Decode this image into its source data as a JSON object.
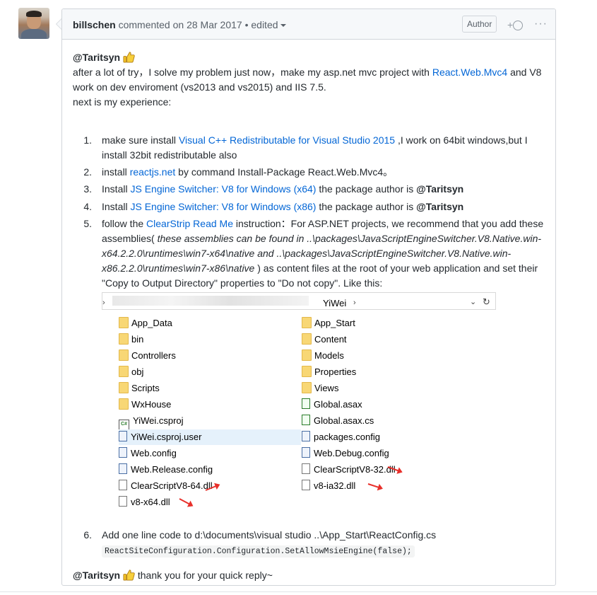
{
  "comment": {
    "author": "billschen",
    "action": "commented on",
    "date": "28 Mar 2017",
    "separator": "•",
    "edited": "edited",
    "author_badge": "Author",
    "reaction_plus": "+",
    "more_menu": "···"
  },
  "body": {
    "mention": "@Taritsyn",
    "intro_text_1": "after a lot of try，I solve my problem just now，make my asp.net mvc project with ",
    "intro_link": "React.Web.Mvc4",
    "intro_text_2": " and V8 work on dev enviroment (vs2013 and vs2015) and IIS 7.5.",
    "intro_text_3": "next is my experience:",
    "steps": [
      {
        "num": "1.",
        "pre": "make sure install ",
        "link": "Visual C++ Redistributable for Visual Studio 2015 ",
        "post": ",I work on 64bit windows,but I install 32bit redistributable also"
      },
      {
        "num": "2.",
        "pre": "install ",
        "link": "reactjs.net",
        "post": " by command Install-Package React.Web.Mvc4。"
      },
      {
        "num": "3.",
        "pre": "Install ",
        "link": "JS Engine Switcher: V8 for Windows (x64)",
        "post": " the package author is ",
        "mention": "@Taritsyn"
      },
      {
        "num": "4.",
        "pre": "Install ",
        "link": "JS Engine Switcher: V8 for Windows (x86)",
        "post": " the package author is ",
        "mention": "@Taritsyn"
      },
      {
        "num": "5.",
        "pre": "follow the ",
        "link": "ClearStrip Read Me",
        "post1": " instruction：For ASP.NET projects, we recommend that you add these assemblies( ",
        "italic": "these assemblies can be found in ..\\packages\\JavaScriptEngineSwitcher.V8.Native.win-x64.2.2.0\\runtimes\\win7-x64\\native and ..\\packages\\JavaScriptEngineSwitcher.V8.Native.win-x86.2.2.0\\runtimes\\win7-x86\\native",
        "post2": " ) as content files at the root of your web application and set their \"Copy to Output Directory\" properties to \"Do not copy\". Like this:"
      },
      {
        "num": "6.",
        "pre": "Add one line code to d:\\documents\\visual studio ..\\App_Start\\ReactConfig.cs",
        "code": "ReactSiteConfiguration.Configuration.SetAllowMsieEngine(false);"
      }
    ],
    "closing_mention": "@Taritsyn",
    "closing_text": " thank you for your quick reply~"
  },
  "explorer": {
    "address_segment": "YiWei",
    "address_chevron": "›",
    "dropdown_icon": "chevron-down-icon",
    "refresh_icon": "refresh-icon",
    "left_column": [
      {
        "name": "App_Data",
        "icon": "folder-icon"
      },
      {
        "name": "bin",
        "icon": "folder-icon"
      },
      {
        "name": "Controllers",
        "icon": "folder-icon"
      },
      {
        "name": "obj",
        "icon": "folder-icon"
      },
      {
        "name": "Scripts",
        "icon": "folder-icon"
      },
      {
        "name": "WxHouse",
        "icon": "folder-icon"
      },
      {
        "name": "YiWei.csproj",
        "icon": "csproj-file-icon"
      },
      {
        "name": "YiWei.csproj.user",
        "icon": "user-file-icon"
      },
      {
        "name": "Web.config",
        "icon": "config-file-icon"
      },
      {
        "name": "Web.Release.config",
        "icon": "config-file-icon"
      },
      {
        "name": "ClearScriptV8-64.dll",
        "icon": "dll-file-icon"
      },
      {
        "name": "v8-x64.dll",
        "icon": "dll-file-icon"
      }
    ],
    "right_column": [
      {
        "name": "App_Start",
        "icon": "folder-icon"
      },
      {
        "name": "Content",
        "icon": "folder-icon"
      },
      {
        "name": "Models",
        "icon": "folder-icon"
      },
      {
        "name": "Properties",
        "icon": "folder-icon"
      },
      {
        "name": "Views",
        "icon": "folder-icon"
      },
      {
        "name": "Global.asax",
        "icon": "asax-file-icon"
      },
      {
        "name": "Global.asax.cs",
        "icon": "cs-file-icon"
      },
      {
        "name": "packages.config",
        "icon": "config-file-icon"
      },
      {
        "name": "Web.Debug.config",
        "icon": "config-file-icon"
      },
      {
        "name": "ClearScriptV8-32.dll",
        "icon": "dll-file-icon"
      },
      {
        "name": "v8-ia32.dll",
        "icon": "dll-file-icon"
      }
    ],
    "selected_item": "YiWei.csproj.user",
    "arrow_color": "#e8302b"
  },
  "colors": {
    "link": "#0366d6",
    "header_bg": "#f6f8fa",
    "border": "#d1d5da",
    "selection": "#e5f1fb"
  }
}
